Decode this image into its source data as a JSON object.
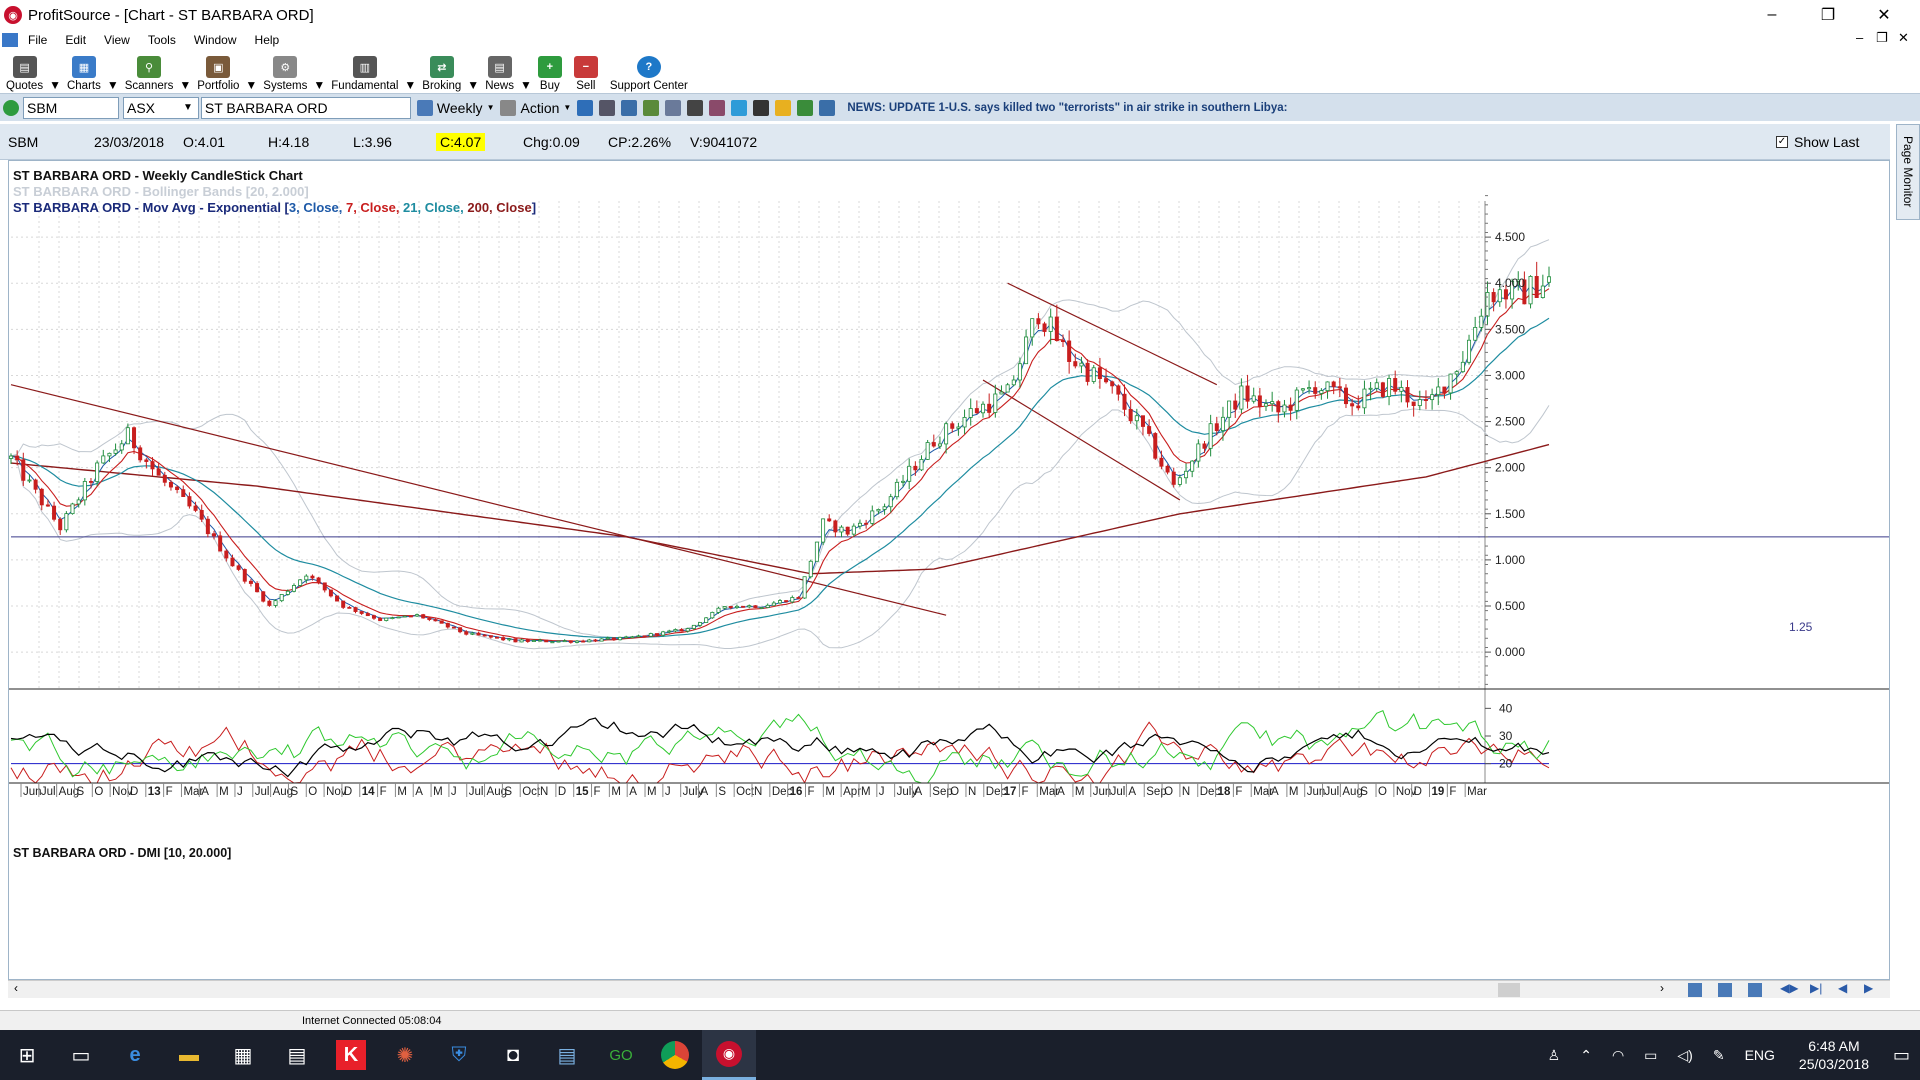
{
  "window": {
    "title": "ProfitSource - [Chart - ST BARBARA ORD]",
    "minimize": "–",
    "restore": "❐",
    "close": "✕"
  },
  "menu": [
    "File",
    "Edit",
    "View",
    "Tools",
    "Window",
    "Help"
  ],
  "toolbar": [
    {
      "label": "Quotes",
      "icon": "quotes-icon",
      "color": "#555555"
    },
    {
      "label": "Charts",
      "icon": "charts-icon",
      "color": "#3a7bc8"
    },
    {
      "label": "Scanners",
      "icon": "scanners-icon",
      "color": "#4a8c3a"
    },
    {
      "label": "Portfolio",
      "icon": "portfolio-icon",
      "color": "#7a5a3a"
    },
    {
      "label": "Systems",
      "icon": "systems-icon",
      "color": "#888888"
    },
    {
      "label": "Fundamental",
      "icon": "fundamental-icon",
      "color": "#555555"
    },
    {
      "label": "Broking",
      "icon": "broking-icon",
      "color": "#3a8c5a"
    },
    {
      "label": "News",
      "icon": "news-icon",
      "color": "#666666"
    },
    {
      "label": "Buy",
      "icon": "buy-icon",
      "color": "#2e9b3e"
    },
    {
      "label": "Sell",
      "icon": "sell-icon",
      "color": "#c83a3a"
    },
    {
      "label": "Support Center",
      "icon": "help-icon",
      "color": "#1e78c8"
    }
  ],
  "symbar": {
    "code": "SBM",
    "exchange": "ASX",
    "name": "ST BARBARA ORD",
    "period": "Weekly",
    "action": "Action",
    "news": "NEWS: UPDATE 1-U.S. says killed two \"terrorists\" in air strike in southern Libya:"
  },
  "info": {
    "code": "SBM",
    "date": "23/03/2018",
    "open": "O:4.01",
    "high": "H:4.18",
    "low": "L:3.96",
    "close": "C:4.07",
    "chg": "Chg:0.09",
    "cp": "CP:2.26%",
    "vol": "V:9041072",
    "show_last": "Show Last"
  },
  "sidebar": "Page Monitor",
  "status": "Internet Connected 05:08:04",
  "taskbar": {
    "time": "6:48 AM",
    "date": "25/03/2018",
    "lang": "ENG"
  },
  "chart_data": {
    "type": "candlestick",
    "title": "ST BARBARA ORD - Weekly CandleStick Chart",
    "bb_label": "ST BARBARA ORD - Bollinger Bands [20, 2.000]",
    "ma_label_prefix": "ST BARBARA ORD - Mov Avg - Exponential [",
    "ma_params": [
      {
        "text": "3, Close, ",
        "color": "#1e5aa8"
      },
      {
        "text": "7, Close, ",
        "color": "#c81e1e"
      },
      {
        "text": "21, Close, ",
        "color": "#1e8ca0"
      },
      {
        "text": "200, Close",
        "color": "#8b1a1a"
      }
    ],
    "ma_label_suffix": "]",
    "hline_label": "1.25",
    "hline_value": 1.25,
    "ylim": [
      -0.4,
      5.0
    ],
    "yticks": [
      "4.500",
      "4.000",
      "3.500",
      "3.000",
      "2.500",
      "2.000",
      "1.500",
      "1.000",
      "0.500",
      "0.000"
    ],
    "ytick_values": [
      4.5,
      4.0,
      3.5,
      3.0,
      2.5,
      2.0,
      1.5,
      1.0,
      0.5,
      0.0
    ],
    "price_keypoints": [
      [
        0,
        2.1
      ],
      [
        8,
        1.35
      ],
      [
        14,
        2.0
      ],
      [
        19,
        2.35
      ],
      [
        24,
        1.9
      ],
      [
        30,
        1.5
      ],
      [
        36,
        0.95
      ],
      [
        42,
        0.5
      ],
      [
        48,
        0.85
      ],
      [
        54,
        0.5
      ],
      [
        60,
        0.35
      ],
      [
        66,
        0.4
      ],
      [
        74,
        0.2
      ],
      [
        82,
        0.12
      ],
      [
        92,
        0.12
      ],
      [
        100,
        0.15
      ],
      [
        110,
        0.25
      ],
      [
        116,
        0.5
      ],
      [
        122,
        0.5
      ],
      [
        128,
        0.6
      ],
      [
        132,
        1.4
      ],
      [
        136,
        1.3
      ],
      [
        142,
        1.6
      ],
      [
        150,
        2.3
      ],
      [
        156,
        2.6
      ],
      [
        162,
        2.8
      ],
      [
        167,
        3.7
      ],
      [
        172,
        3.2
      ],
      [
        178,
        2.9
      ],
      [
        184,
        2.4
      ],
      [
        189,
        1.8
      ],
      [
        194,
        2.3
      ],
      [
        200,
        2.8
      ],
      [
        206,
        2.6
      ],
      [
        212,
        2.9
      ],
      [
        218,
        2.7
      ],
      [
        224,
        2.9
      ],
      [
        230,
        2.65
      ],
      [
        236,
        3.2
      ],
      [
        240,
        3.9
      ],
      [
        246,
        3.9
      ],
      [
        250,
        4.07
      ]
    ],
    "ema200_keypoints": [
      [
        0,
        2.05
      ],
      [
        40,
        1.8
      ],
      [
        100,
        1.25
      ],
      [
        130,
        0.85
      ],
      [
        150,
        0.9
      ],
      [
        170,
        1.2
      ],
      [
        190,
        1.5
      ],
      [
        230,
        1.9
      ],
      [
        250,
        2.25
      ]
    ],
    "trendlines": [
      {
        "p1": [
          0,
          2.9
        ],
        "p2": [
          152,
          0.4
        ]
      },
      {
        "p1": [
          162,
          4.0
        ],
        "p2": [
          196,
          2.9
        ]
      },
      {
        "p1": [
          158,
          2.95
        ],
        "p2": [
          190,
          1.65
        ]
      }
    ],
    "dmi_title": "ST BARBARA ORD - DMI [10, 20.000]",
    "dmi_yticks": [
      "40",
      "30",
      "20"
    ],
    "dmi_ytick_values": [
      40,
      30,
      20
    ],
    "dmi_ylim": [
      13,
      47
    ],
    "dmi_level": 20,
    "x_labels": [
      "Jun",
      "Jul",
      "Aug",
      "S",
      "O",
      "Nov",
      "D",
      "13",
      "F",
      "Mar",
      "A",
      "M",
      "J",
      "Jul",
      "Aug",
      "S",
      "O",
      "Nov",
      "D",
      "14",
      "F",
      "M",
      "A",
      "M",
      "J",
      "Jul",
      "Aug",
      "S",
      "Oct",
      "N",
      "D",
      "15",
      "F",
      "M",
      "A",
      "M",
      "J",
      "July",
      "A",
      "S",
      "Oct",
      "N",
      "Dec",
      "16",
      "F",
      "M",
      "Apr",
      "M",
      "J",
      "July",
      "A",
      "Sep",
      "O",
      "N",
      "Dec",
      "17",
      "F",
      "Mar",
      "A",
      "M",
      "Jun",
      "Jul",
      "A",
      "Sep",
      "O",
      "N",
      "Dec",
      "18",
      "F",
      "Mar",
      "A",
      "M",
      "Jun",
      "Jul",
      "Aug",
      "S",
      "O",
      "Nov",
      "D",
      "19",
      "F",
      "Mar"
    ]
  },
  "colors": {
    "up": "#1e8c3c",
    "down": "#c81e1e",
    "ema3": "#1e5aa8",
    "ema7": "#c81e1e",
    "ema21": "#1e8ca0",
    "ema200": "#8b1a1a",
    "bb": "#bfc6ce",
    "trend": "#8b1a1a",
    "hline": "#3a3a8a",
    "adx": "#000000",
    "dip": "#2ec82e",
    "dim": "#c81e1e"
  }
}
